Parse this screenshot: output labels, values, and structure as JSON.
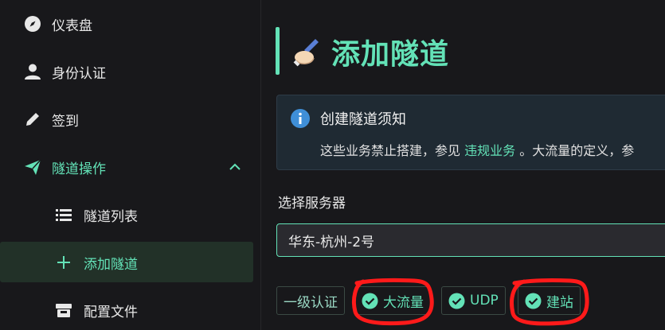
{
  "sidebar": {
    "items": [
      {
        "label": "仪表盘",
        "icon": "compass-icon"
      },
      {
        "label": "身份认证",
        "icon": "user-icon"
      },
      {
        "label": "签到",
        "icon": "pencil-icon"
      },
      {
        "label": "隧道操作",
        "icon": "send-icon"
      }
    ],
    "sub_items": [
      {
        "label": "隧道列表",
        "icon": "list-icon"
      },
      {
        "label": "添加隧道",
        "icon": "plus-icon"
      },
      {
        "label": "配置文件",
        "icon": "archive-icon"
      }
    ]
  },
  "page": {
    "title": "添加隧道",
    "title_icon": "writing-hand-emoji"
  },
  "notice": {
    "title": "创建隧道须知",
    "body_prefix": "这些业务禁止搭建，参见 ",
    "link_text": "违规业务",
    "body_suffix": " 。大流量的定义，参"
  },
  "form": {
    "server_label": "选择服务器",
    "server_value": "华东-杭州-2号"
  },
  "tags": [
    {
      "label": "一级认证",
      "checked": false
    },
    {
      "label": "大流量",
      "checked": true
    },
    {
      "label": "UDP",
      "checked": true
    },
    {
      "label": "建站",
      "checked": true
    }
  ],
  "colors": {
    "accent": "#63e2b7",
    "background": "#18181b",
    "selected_bg": "#223128",
    "annotation_red": "#ff1a1a"
  }
}
